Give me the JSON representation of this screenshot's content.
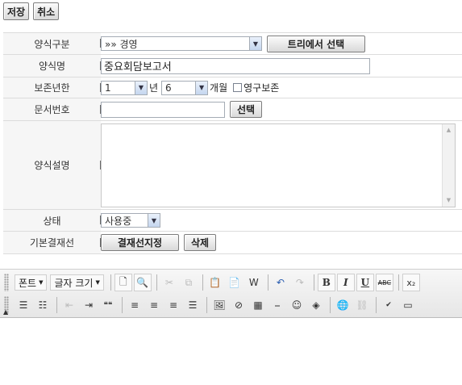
{
  "actions": {
    "save_label": "저장",
    "cancel_label": "취소"
  },
  "form": {
    "category": {
      "label": "양식구분",
      "value": "»» 경영",
      "button": "트리에서 선택"
    },
    "name": {
      "label": "양식명",
      "value": "중요회담보고서"
    },
    "retention": {
      "label": "보존년한",
      "years_value": "1",
      "years_unit": "년",
      "months_value": "6",
      "months_unit": "개월",
      "permanent_label": "영구보존",
      "permanent_checked": false
    },
    "doc_number": {
      "label": "문서번호",
      "value": "",
      "button": "선택"
    },
    "description": {
      "label": "양식설명",
      "value": ""
    },
    "status": {
      "label": "상태",
      "value": "사용중"
    },
    "approval_line": {
      "label": "기본결재선",
      "set_button": "결재선지정",
      "delete_button": "삭제"
    }
  },
  "editor": {
    "font_label": "폰트",
    "size_label": "글자 크기",
    "bold": "B",
    "italic": "I",
    "underline": "U",
    "strike": "ABC",
    "subscript": "x₂",
    "quote": "❝❝"
  }
}
